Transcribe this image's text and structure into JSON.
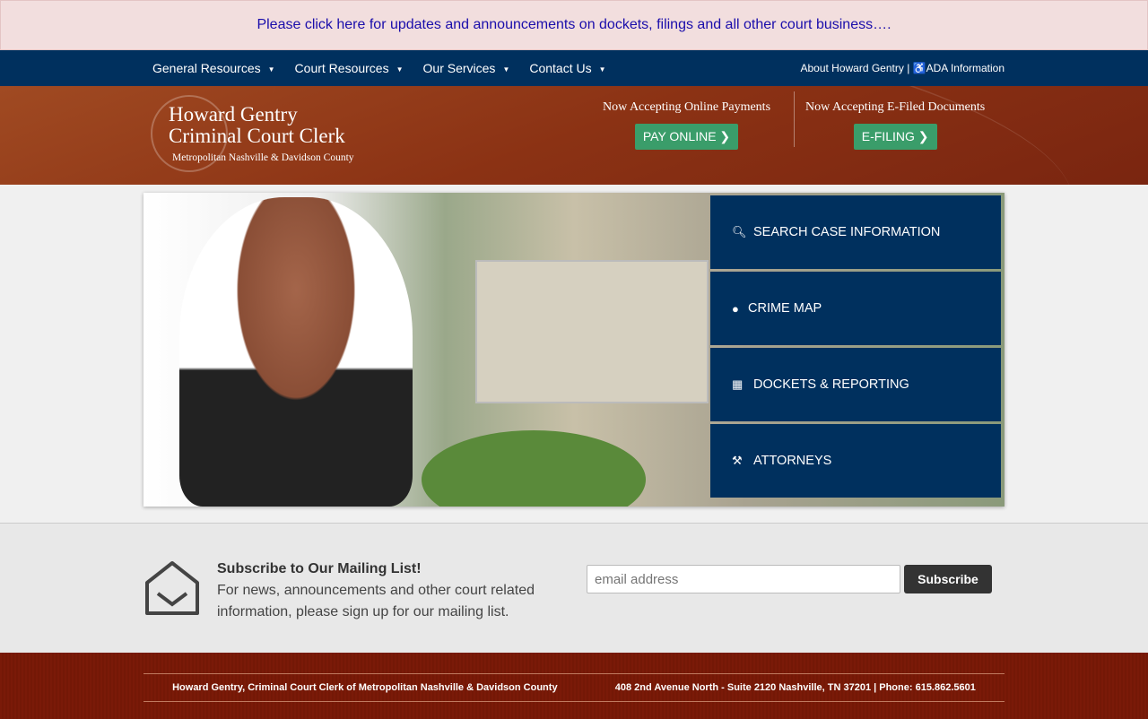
{
  "announcement": "Please click here for updates and announcements on dockets, filings and all other court business….",
  "nav": {
    "items": [
      {
        "label": "General Resources"
      },
      {
        "label": "Court Resources"
      },
      {
        "label": "Our Services"
      },
      {
        "label": "Contact Us"
      }
    ],
    "caret": "▼",
    "about": "About Howard Gentry",
    "separator": "|",
    "ada": "ADA Information"
  },
  "header": {
    "title_line1": "Howard Gentry",
    "title_line2": "Criminal Court Clerk",
    "subtitle": "Metropolitan Nashville & Davidson County",
    "payments": {
      "caption": "Now Accepting Online Payments",
      "button": "PAY ONLINE ❯"
    },
    "efiling": {
      "caption": "Now Accepting E-Filed Documents",
      "button": "E-FILING ❯"
    }
  },
  "side_menu": [
    {
      "label": "SEARCH CASE INFORMATION",
      "icon": "search-icon"
    },
    {
      "label": "CRIME MAP",
      "icon": "map-marker-icon"
    },
    {
      "label": "DOCKETS & REPORTING",
      "icon": "calendar-icon"
    },
    {
      "label": "ATTORNEYS",
      "icon": "gavel-icon"
    }
  ],
  "subscribe": {
    "heading": "Subscribe to Our Mailing List!",
    "text": "For news, announcements and other court related information, please sign up for our mailing list.",
    "placeholder": "email address",
    "button": "Subscribe"
  },
  "footer": {
    "left": "Howard Gentry, Criminal Court Clerk of Metropolitan Nashville & Davidson County",
    "right": "408 2nd Avenue North - Suite 2120 Nashville, TN 37201 | Phone: 615.862.5601"
  },
  "colors": {
    "navy": "#00305e",
    "rust": "#8b3214",
    "green": "#3a9d6a",
    "footer": "#7a1a08"
  }
}
